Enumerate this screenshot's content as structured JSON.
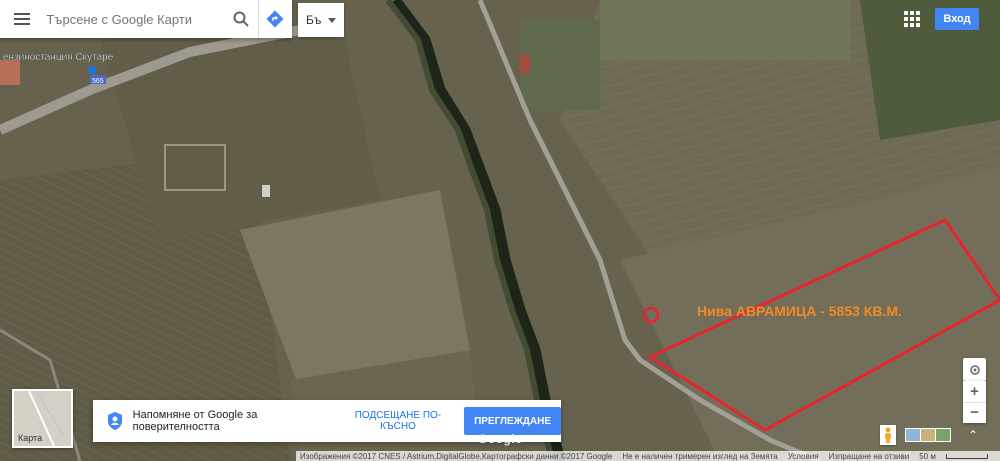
{
  "search": {
    "placeholder": "Търсене с Google Карти"
  },
  "language": {
    "label": "Бъ"
  },
  "header": {
    "signin_label": "Вход"
  },
  "map": {
    "place_label": "ензиностанция Скутаре",
    "road_label": "565",
    "annotation": "Нива АВРАМИЦА - 5853 КВ.М.",
    "annotation_color": "#f28a25",
    "outline_color": "#e8232d"
  },
  "minimap": {
    "label": "Карта"
  },
  "privacy": {
    "message": "Напомняне от Google за поверителността",
    "later_label": "ПОДСЕЩАНЕ ПО-КЪСНО",
    "review_label": "ПРЕГЛЕЖДАНЕ"
  },
  "watermark": "Google",
  "footer": {
    "imagery": "Изображения ©2017 CNES / Astrium,DigitalGlobe,Картографски данни ©2017 Google",
    "no_3d": "Не е наличен тримерен изглед на Земята",
    "terms": "Условия",
    "feedback": "Изпращане на отзиви",
    "scale": "50 м"
  },
  "icons": {
    "menu": "menu-icon",
    "search": "search-icon",
    "directions": "directions-icon",
    "dropdown": "chevron-down-icon",
    "apps": "apps-icon",
    "locate": "my-location-icon",
    "zoom_in": "plus-icon",
    "zoom_out": "minus-icon",
    "pegman": "pegman-icon",
    "expand": "expand-icon"
  }
}
